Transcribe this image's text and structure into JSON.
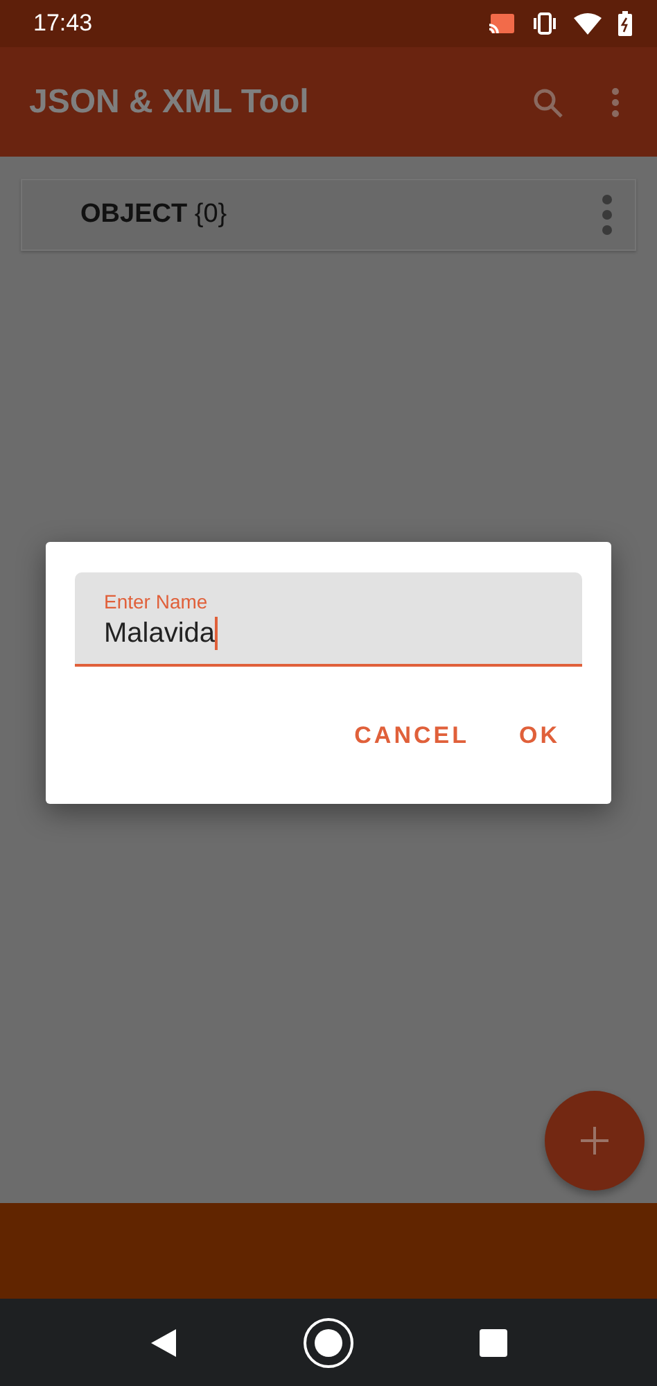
{
  "status_bar": {
    "time": "17:43"
  },
  "app_bar": {
    "title": "JSON & XML Tool"
  },
  "tree": [
    {
      "type": "OBJECT",
      "count": "{0}"
    }
  ],
  "dialog": {
    "field": {
      "label": "Enter Name",
      "value": "Malavida",
      "focused": true
    },
    "buttons": [
      "CANCEL",
      "OK"
    ]
  }
}
